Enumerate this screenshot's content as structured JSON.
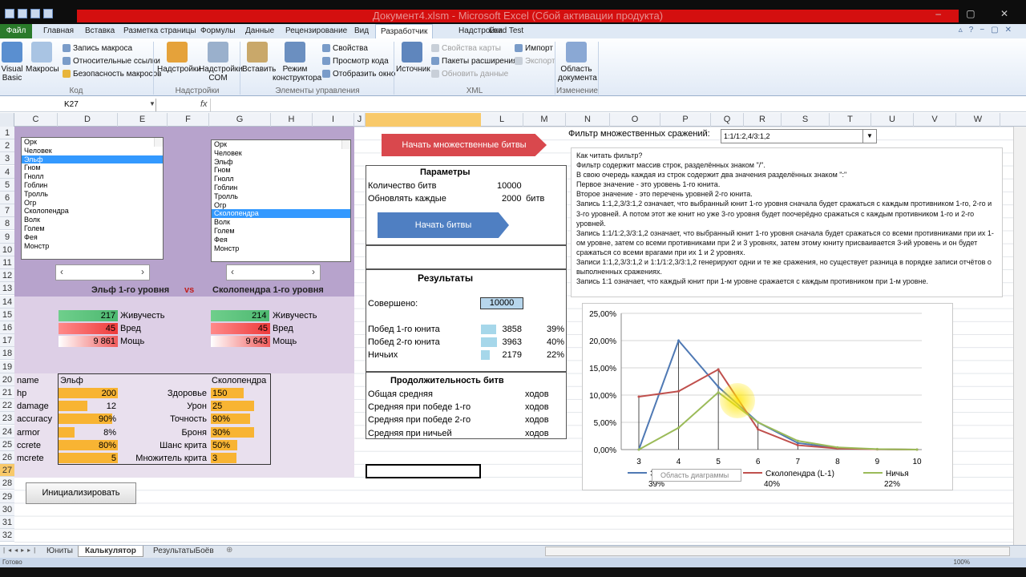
{
  "window": {
    "title": "Документ4.xlsm  -  Microsoft Excel (Сбой активации продукта)",
    "controls": "– ▢ ✕"
  },
  "ribbon_tabs": [
    "Главная",
    "Вставка",
    "Разметка страницы",
    "Формулы",
    "Данные",
    "Рецензирование",
    "Вид",
    "Разработчик",
    "Надстройки",
    "Load Test"
  ],
  "file_tab": "Файл",
  "ribbon": {
    "code": {
      "visual_basic": "Visual Basic",
      "macros": "Макросы",
      "rec_macro": "Запись макроса",
      "rel_links": "Относительные ссылки",
      "macro_sec": "Безопасность макросов",
      "group": "Код"
    },
    "addins": {
      "addins": "Надстройки",
      "com": "Надстройки COM",
      "group": "Надстройки"
    },
    "controls": {
      "insert": "Вставить",
      "design": "Режим конструктора",
      "props": "Свойства",
      "view_code": "Просмотр кода",
      "dialog": "Отобразить окно",
      "group": "Элементы управления"
    },
    "xml": {
      "source": "Источник",
      "map_props": "Свойства карты",
      "ext_packs": "Пакеты расширения",
      "refresh": "Обновить данные",
      "import": "Импорт",
      "export": "Экспорт",
      "group": "XML"
    },
    "modify": {
      "doc_panel": "Область документа",
      "group": "Изменение"
    }
  },
  "formula_bar": {
    "cell": "K27",
    "fx": "fx",
    "value": ""
  },
  "columns": [
    "C",
    "D",
    "E",
    "F",
    "G",
    "H",
    "I",
    "J",
    "K",
    "L",
    "M",
    "N",
    "O",
    "P",
    "Q",
    "R",
    "S",
    "T",
    "U",
    "V",
    "W"
  ],
  "rows": [
    "1",
    "2",
    "3",
    "4",
    "5",
    "6",
    "7",
    "8",
    "9",
    "10",
    "11",
    "12",
    "13",
    "14",
    "15",
    "16",
    "17",
    "18",
    "19",
    "20",
    "21",
    "22",
    "23",
    "24",
    "25",
    "26",
    "27",
    "28",
    "29",
    "30",
    "31",
    "32"
  ],
  "unit_list": [
    "Орк",
    "Человек",
    "Эльф",
    "Гном",
    "Гнолл",
    "Гоблин",
    "Тролль",
    "Огр",
    "Сколопендра",
    "Волк",
    "Голем",
    "Фея",
    "Монстр"
  ],
  "list1_selected": "Эльф",
  "list2_selected": "Сколопендра",
  "matchup": {
    "left": "Эльф 1-го уровня",
    "vs": "vs",
    "right": "Сколопендра 1-го уровня"
  },
  "stats": {
    "left": {
      "hp": "217",
      "dmg": "45",
      "power": "9 861"
    },
    "right": {
      "hp": "214",
      "dmg": "45",
      "power": "9 643"
    },
    "labels": {
      "hp": "Живучесть",
      "dmg": "Вред",
      "power": "Мощь"
    },
    "hp_fill": {
      "left": 0.95,
      "right": 0.93
    }
  },
  "unit_table": {
    "header": {
      "col1": "name",
      "col2": "Эльф",
      "col3": "Сколопендра"
    },
    "rows": [
      {
        "key": "hp",
        "left": "200",
        "mid": "Здоровье",
        "right": "150",
        "lf": 1.0,
        "rf": 0.75
      },
      {
        "key": "damage",
        "left": "12",
        "mid": "Урон",
        "right": "25",
        "lf": 0.48,
        "rf": 1.0
      },
      {
        "key": "accuracy",
        "left": "90%",
        "mid": "Точность",
        "right": "90%",
        "lf": 0.9,
        "rf": 0.9
      },
      {
        "key": "armor",
        "left": "8%",
        "mid": "Броня",
        "right": "30%",
        "lf": 0.27,
        "rf": 1.0
      },
      {
        "key": "ccrete",
        "left": "80%",
        "mid": "Шанс крита",
        "right": "50%",
        "lf": 1.0,
        "rf": 0.62
      },
      {
        "key": "mcrete",
        "left": "5",
        "mid": "Множитель крита",
        "right": "3",
        "lf": 1.0,
        "rf": 0.6
      }
    ]
  },
  "init_button": "Инициализировать",
  "multi_button": "Начать множественные битвы",
  "params": {
    "title": "Параметры",
    "count_label": "Количество битв",
    "count": "10000",
    "refresh_label": "Обновлять каждые",
    "refresh": "2000",
    "refresh_unit": "битв",
    "start_button": "Начать битвы"
  },
  "results": {
    "title": "Результаты",
    "done_label": "Совершено:",
    "done": "10000",
    "rows": [
      {
        "label": "Побед 1-го юнита",
        "count": "3858",
        "pct": "39%",
        "fill": 0.97
      },
      {
        "label": "Побед 2-го юнита",
        "count": "3963",
        "pct": "40%",
        "fill": 1.0
      },
      {
        "label": "Ничьих",
        "count": "2179",
        "pct": "22%",
        "fill": 0.55
      }
    ]
  },
  "duration": {
    "title": "Продолжительность битв",
    "unit": "ходов",
    "rows": [
      "Общая средняя",
      "Средняя при победе 1-го",
      "Средняя при победе 2-го",
      "Средняя при ничьей"
    ]
  },
  "filter": {
    "label": "Фильтр множественных сражений:",
    "value": "1:1/1:2,4/3:1,2"
  },
  "help": [
    "Как читать фильтр?",
    "Фильтр содержит массив строк, разделённых знаком \"/\".",
    "В свою очередь каждая из строк содержит два значения разделённых знаком \":\"",
    "Первое значение - это уровень 1-го юнита.",
    "Второе значение - это перечень уровней 2-го юнита.",
    "Запись 1:1,2,3/3:1,2  означает, что выбранный юнит 1-го уровня сначала будет сражаться с каждым противником 1-го, 2-го и 3-го уровней. А потом этот же юнит но уже 3-го уровня будет поочерёдно сражаться с каждым противником 1-го и 2-го уровней.",
    "Запись 1:1/1:2,3/3:1,2  означает, что выбранный юнит 1-го уровня сначала будет сражаться со всеми противниками при их 1-ом уровне, затем со всеми противниками при 2 и 3 уровнях, затем этому юниту присваивается 3-ий уровень и он будет сражаться со всеми врагами при их 1 и 2 уровнях.",
    "Записи 1:1,2,3/3:1,2  и 1:1/1:2,3/3:1,2  генерируют одни и те же сражения, но существует разница в порядке записи отчётов о выполненных сражениях.",
    "Запись 1:1 означает, что каждый юнит при 1-м уровне сражается с каждым противником при 1-м уровне."
  ],
  "chart_data": {
    "type": "line",
    "x": [
      3,
      4,
      5,
      6,
      7,
      8,
      9,
      10
    ],
    "ylim": [
      0,
      0.25
    ],
    "yticks": [
      "0,00%",
      "5,00%",
      "10,00%",
      "15,00%",
      "20,00%",
      "25,00%"
    ],
    "grid": true,
    "legend_position": "bottom",
    "tooltip": "Область диаграммы",
    "series": [
      {
        "name": "Эльф (L-1)",
        "pct": "39%",
        "color": "#4f79b4",
        "values": [
          0,
          0.2,
          0.115,
          0.05,
          0.012,
          0.003,
          0.0005,
          0
        ]
      },
      {
        "name": "Сколопендра (L-1)",
        "pct": "40%",
        "color": "#c0504d",
        "values": [
          0.097,
          0.107,
          0.147,
          0.037,
          0.008,
          0.002,
          0.0005,
          0
        ]
      },
      {
        "name": "Ничья",
        "pct": "22%",
        "color": "#9bbb59",
        "values": [
          0,
          0.04,
          0.105,
          0.05,
          0.016,
          0.004,
          0.001,
          0
        ]
      }
    ]
  },
  "sheets": [
    "Юниты",
    "Калькулятор",
    "РезультатыБоёв"
  ],
  "active_sheet": "Калькулятор",
  "status": "Готово",
  "zoom": "100%"
}
